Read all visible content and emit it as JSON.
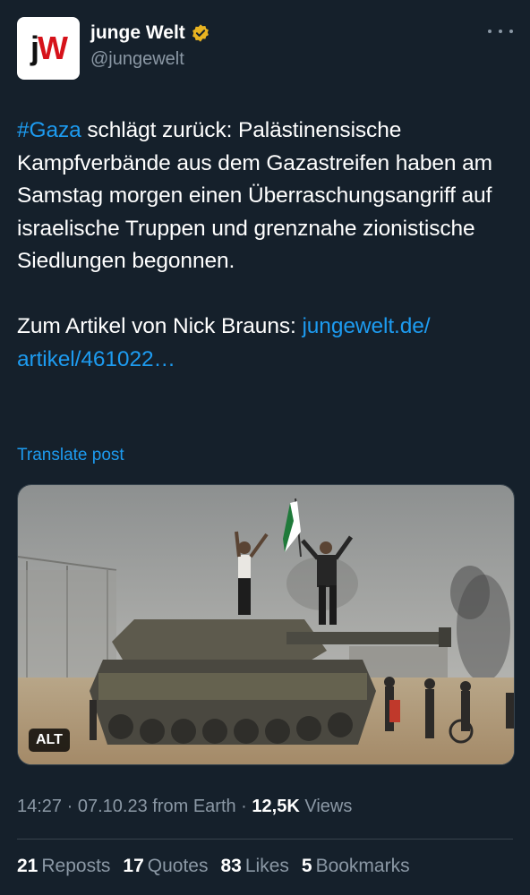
{
  "account": {
    "display_name": "junge Welt",
    "handle": "@jungewelt",
    "logo_j": "j",
    "logo_w": "W",
    "verified_color": "#e8b321"
  },
  "tweet": {
    "hashtag": "#Gaza",
    "paragraph1": " schlägt zurück: Palästinensische Kampfverbände aus dem Gazastreifen haben am Samstag morgen einen Überraschungsangriff auf israelische Truppen und grenznahe zionistische Siedlungen begonnen.",
    "paragraph2_prefix": "Zum Artikel von Nick Brauns: ",
    "link_text": "jungewelt.de/ artikel/461022…"
  },
  "translate_label": "Translate post",
  "media": {
    "alt_label": "ALT"
  },
  "meta": {
    "time": "14:27",
    "sep": " · ",
    "date": "07.10.23",
    "source": " from Earth",
    "views_count": "12,5K",
    "views_label": " Views"
  },
  "stats": [
    {
      "count": "21",
      "label": "Reposts"
    },
    {
      "count": "17",
      "label": "Quotes"
    },
    {
      "count": "83",
      "label": "Likes"
    },
    {
      "count": "5",
      "label": "Bookmarks"
    }
  ],
  "colors": {
    "background": "#15202b",
    "link": "#1d9bf0",
    "muted": "#8b98a5"
  },
  "icons": [
    "verified-badge-icon",
    "more-options-icon"
  ]
}
